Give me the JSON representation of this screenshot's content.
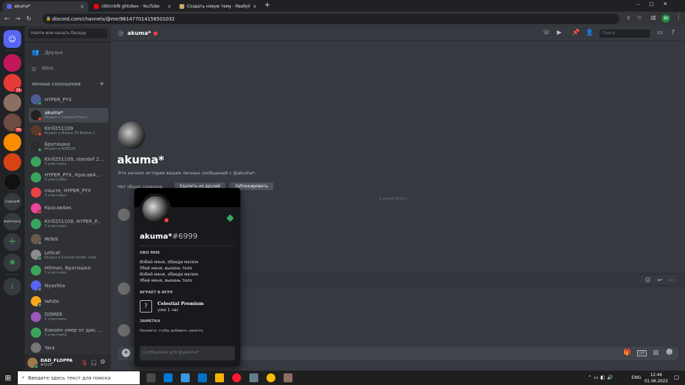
{
  "browser": {
    "tabs": [
      {
        "title": "akuma*",
        "color": "#5865f2"
      },
      {
        "title": "ctktcnbfk ghtvbev - YouTube",
        "color": "#ff0000"
      },
      {
        "title": "Создать новую тему - ReallyWo...",
        "color": "#c9a86a"
      }
    ],
    "new_tab": "+",
    "url": "discord.com/channels/@me/981477014156501032",
    "profile_letter": "M"
  },
  "sidebar": {
    "search_placeholder": "Найти или начать беседу",
    "friends": "Друзья",
    "nitro": "Nitro",
    "dm_header": "ЛИЧНЫЕ СООБЩЕНИЯ",
    "dm_add": "+",
    "dms": [
      {
        "name": "HYPER_PYX",
        "sub": "",
        "color": "#4e5d94",
        "status": "#3ba55d"
      },
      {
        "name": "akuma*",
        "sub": "Играет в Celestial Premi...",
        "color": "#222",
        "status": "#ed4245"
      },
      {
        "name": "Kirill251109",
        "sub": "Играет в Bloons TD Battles 2",
        "color": "#5b3a2a",
        "status": "#ed4245"
      },
      {
        "name": "Братишка",
        "sub": "Играет в ROBLOX",
        "color": "#2b2b2b",
        "status": "#3ba55d"
      },
      {
        "name": "Kirill251109, standof 2 ...",
        "sub": "3 участника",
        "color": "#3ba55d",
        "status": ""
      },
      {
        "name": "HYPER_PYX, Красав4...",
        "sub": "3 участника",
        "color": "#3ba55d",
        "status": ""
      },
      {
        "name": "паште, HYPER_PYX",
        "sub": "3 участника",
        "color": "#ed4245",
        "status": ""
      },
      {
        "name": "Красав4ик",
        "sub": "",
        "color": "#eb459e",
        "status": "#ed4245"
      },
      {
        "name": "Kirill251109, HYPER_P...",
        "sub": "3 участника",
        "color": "#3ba55d",
        "status": ""
      },
      {
        "name": "MrNik",
        "sub": "",
        "color": "#6b5a4a",
        "status": "#747f8d"
      },
      {
        "name": "Leticel",
        "sub": "Играет в Counter-Strike: Glob...",
        "color": "#8b8b8b",
        "status": "#3ba55d"
      },
      {
        "name": "Hitman, Братишка",
        "sub": "3 участника",
        "color": "#3ba55d",
        "status": ""
      },
      {
        "name": "Nyashka",
        "sub": "",
        "color": "#5865f2",
        "status": "#747f8d"
      },
      {
        "name": "Iwhite",
        "sub": "",
        "color": "#faa61a",
        "status": "#747f8d"
      },
      {
        "name": "DOMER",
        "sub": "2 участника",
        "color": "#9b59b6",
        "status": ""
      },
      {
        "name": "Какойн умер от дио, ...",
        "sub": "3 участника",
        "color": "#3ba55d",
        "status": ""
      },
      {
        "name": "Yara",
        "sub": "",
        "color": "#777",
        "status": ""
      }
    ],
    "user": {
      "name": "DAD_FLOPPA",
      "tag": "#5526"
    }
  },
  "servers": [
    {
      "kind": "home",
      "color": "#5865f2"
    },
    {
      "kind": "img",
      "color": "#c2185b",
      "badge": ""
    },
    {
      "kind": "img",
      "color": "#e53935",
      "badge": "21"
    },
    {
      "kind": "img",
      "color": "#8d6e63",
      "badge": ""
    },
    {
      "kind": "img",
      "color": "#6d4c41",
      "badge": "30"
    },
    {
      "kind": "img",
      "color": "#fb8c00",
      "badge": ""
    },
    {
      "kind": "img",
      "color": "#d84315",
      "badge": ""
    },
    {
      "kind": "img",
      "color": "#111",
      "badge": ""
    },
    {
      "kind": "text",
      "label": "СерверМ"
    },
    {
      "kind": "text",
      "label": "верEпорчу"
    }
  ],
  "channel": {
    "at": "@",
    "name": "akuma*",
    "search_placeholder": "Поиск",
    "intro_name": "akuma*",
    "intro_text": "Это начало истории ваших личных сообщений с @akuma*.",
    "no_common": "Нет общих серверов",
    "remove_friend": "Удалить из друзей",
    "block": "Заблокировать",
    "date_divider": "1 июня 2022 г.",
    "composer_add": "+"
  },
  "popout": {
    "username": "akuma*",
    "tag": "#6999",
    "about_header": "ОБО МНЕ",
    "about_lines": [
      "Избей меня, обведи мелом",
      "Убей меня, выкинь тело",
      "Избей меня, обведи мелом",
      "Убей меня, выкинь тело"
    ],
    "playing_header": "ИГРАЕТ В ИГРУ",
    "game_name": "Celestial Premium",
    "game_time": "уже 1 час",
    "game_icon": "?",
    "note_header": "ЗАМЕТКА",
    "note_placeholder": "Нажмите, чтобы добавить заметку",
    "message_placeholder": "Сообщение для @akuma*"
  },
  "taskbar": {
    "search_placeholder": "Введите здесь текст для поиска",
    "lang": "ENG",
    "time": "12:46",
    "date": "01.06.2022"
  }
}
